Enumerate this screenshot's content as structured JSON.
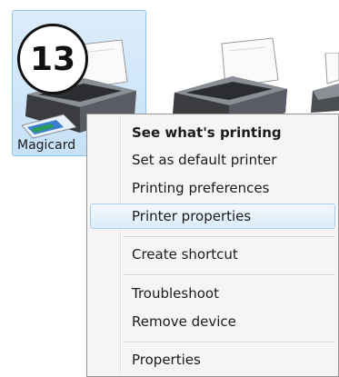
{
  "step": {
    "number": "13"
  },
  "printers": [
    {
      "label": "Magicard",
      "selected": true
    },
    {
      "label": "",
      "selected": false
    },
    {
      "label": "",
      "selected": false
    }
  ],
  "context_menu": {
    "items": [
      {
        "label": "See what's printing",
        "bold": true
      },
      {
        "label": "Set as default printer"
      },
      {
        "label": "Printing preferences"
      },
      {
        "label": "Printer properties",
        "highlighted": true
      },
      {
        "label": "Create shortcut"
      },
      {
        "label": "Troubleshoot"
      },
      {
        "label": "Remove device"
      },
      {
        "label": "Properties"
      }
    ]
  },
  "colors": {
    "selection_fill": "#c6e1f8",
    "selection_border": "#8fc4ee",
    "menu_background": "#f5f5f5",
    "menu_highlight": "#dcecfb"
  },
  "icons": [
    "printer-icon",
    "step-number-badge"
  ]
}
